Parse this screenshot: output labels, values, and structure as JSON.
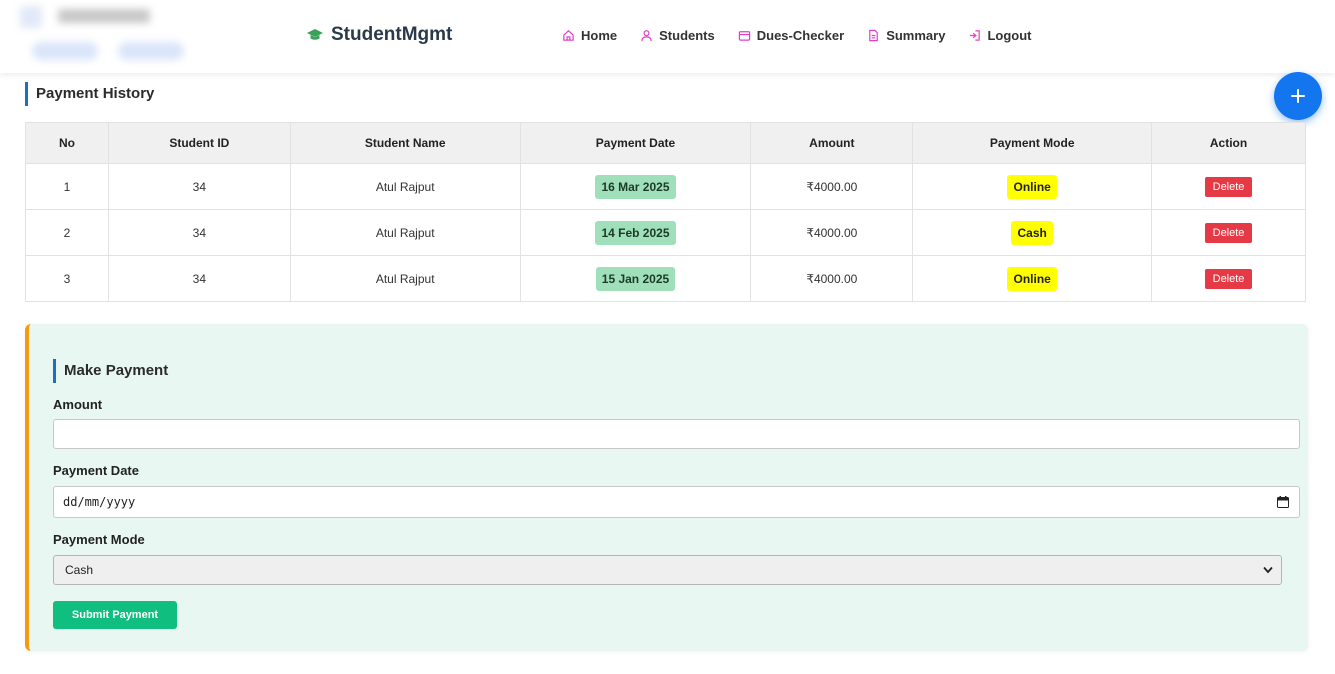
{
  "brand": {
    "name": "StudentMgmt",
    "icon": "graduation-cap-icon",
    "icon_color": "#3aa05a"
  },
  "nav": {
    "accent_color": "#e040c8",
    "items": [
      {
        "label": "Home",
        "icon": "home-icon"
      },
      {
        "label": "Students",
        "icon": "user-icon"
      },
      {
        "label": "Dues-Checker",
        "icon": "wallet-icon"
      },
      {
        "label": "Summary",
        "icon": "document-icon"
      },
      {
        "label": "Logout",
        "icon": "logout-icon"
      }
    ]
  },
  "fab": {
    "icon": "plus-icon",
    "color": "#1476ef"
  },
  "payment_history": {
    "title": "Payment History",
    "columns": [
      "No",
      "Student ID",
      "Student Name",
      "Payment Date",
      "Amount",
      "Payment Mode",
      "Action"
    ],
    "rows": [
      {
        "no": "1",
        "student_id": "34",
        "student_name": "Atul Rajput",
        "payment_date": "16 Mar 2025",
        "amount": "₹4000.00",
        "payment_mode": "Online",
        "action": "Delete"
      },
      {
        "no": "2",
        "student_id": "34",
        "student_name": "Atul Rajput",
        "payment_date": "14 Feb 2025",
        "amount": "₹4000.00",
        "payment_mode": "Cash",
        "action": "Delete"
      },
      {
        "no": "3",
        "student_id": "34",
        "student_name": "Atul Rajput",
        "payment_date": "15 Jan 2025",
        "amount": "₹4000.00",
        "payment_mode": "Online",
        "action": "Delete"
      }
    ]
  },
  "make_payment": {
    "title": "Make Payment",
    "amount_label": "Amount",
    "amount_value": "",
    "date_label": "Payment Date",
    "date_placeholder": "dd/mm/yyyy",
    "mode_label": "Payment Mode",
    "mode_selected": "Cash",
    "submit_label": "Submit Payment"
  },
  "colors": {
    "delete": "#e63946",
    "submit": "#10bf80",
    "card_accent": "#f39c12",
    "date_badge": "#9fe0bb",
    "mode_badge": "#ffff00"
  }
}
